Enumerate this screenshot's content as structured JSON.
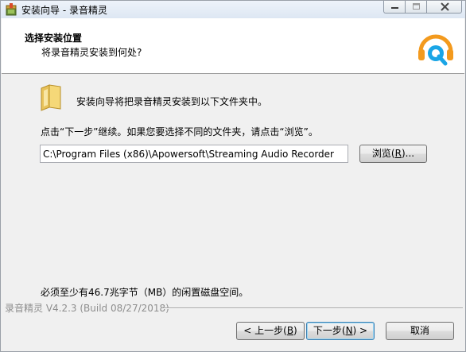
{
  "window": {
    "title": "安装向导 - 录音精灵"
  },
  "header": {
    "title": "选择安装位置",
    "subtitle": "将录音精灵安装到何处?"
  },
  "body": {
    "intro": "安装向导将把录音精灵安装到以下文件夹中。",
    "instruction": "点击“下一步”继续。如果您要选择不同的文件夹，请点击“浏览”。",
    "install_path": "C:\\Program Files (x86)\\Apowersoft\\Streaming Audio Recorder",
    "browse_label_pre": "浏览(",
    "browse_label_key": "R",
    "browse_label_post": ")...",
    "space_note": "必须至少有46.7兆字节（MB）的闲置磁盘空间。"
  },
  "footer": {
    "build_info": "录音精灵 V4.2.3 (Build 08/27/2018)",
    "back_pre": "< 上一步(",
    "back_key": "B",
    "back_post": ")",
    "next_pre": "下一步(",
    "next_key": "N",
    "next_post": ") >",
    "cancel_label": "取消"
  },
  "icons": {
    "app": "installer-box-icon",
    "folder": "folder-icon",
    "logo": "headphones-search-logo"
  },
  "colors": {
    "logo_orange": "#f39a1e",
    "logo_blue": "#1aa5e6",
    "focus_border": "#3c7fb1"
  }
}
